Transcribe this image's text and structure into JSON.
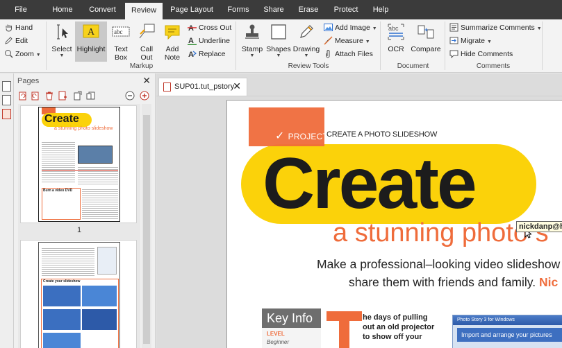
{
  "menu": [
    "File",
    "Home",
    "Convert",
    "Review",
    "Page Layout",
    "Forms",
    "Share",
    "Erase",
    "Protect",
    "Help"
  ],
  "menu_active": "Review",
  "ribbon": {
    "hand_group": {
      "hand": "Hand",
      "edit": "Edit",
      "zoom": "Zoom"
    },
    "markup": {
      "select": "Select",
      "highlight": "Highlight",
      "textbox_line1": "Text",
      "textbox_line2": "Box",
      "callout_line1": "Call",
      "callout_line2": "Out",
      "addnote_line1": "Add",
      "addnote_line2": "Note",
      "crossout": "Cross Out",
      "underline": "Underline",
      "replace": "Replace",
      "group_label": "Markup"
    },
    "review_tools": {
      "stamp": "Stamp",
      "shapes": "Shapes",
      "drawing": "Drawing",
      "add_image": "Add Image",
      "measure": "Measure",
      "attach_files": "Attach Files",
      "group_label": "Review Tools"
    },
    "document": {
      "ocr": "OCR",
      "compare": "Compare",
      "group_label": "Document"
    },
    "comments": {
      "summarize": "Summarize Comments",
      "migrate": "Migrate",
      "hide": "Hide Comments",
      "group_label": "Comments"
    }
  },
  "pages_panel": {
    "title": "Pages",
    "page1_number": "1",
    "thumb1": {
      "headline": "Create",
      "subhead": "a stunning photo slideshow",
      "box_title": "Burn a video DVD"
    },
    "thumb2": {
      "box_title": "Create your slideshow"
    }
  },
  "document": {
    "tab_label": "SUP01.tut_pstory",
    "project_label": "PROJECT",
    "project_title": "CREATE A PHOTO SLIDESHOW",
    "headline": "Create",
    "subhead": "a stunning photo s",
    "intro_line1": "Make a professional–looking video slideshow",
    "intro_line2": "share them with friends and family.",
    "intro_author": "Nic",
    "tooltip": "nickdanp@ho",
    "key_info_title": "Key Info",
    "key_info_level_label": "LEVEL",
    "key_info_level_value": "Beginner",
    "body_text": "he days of pulling out an old projector to show off your",
    "screenshot_title": "Photo Story 3 for Windows",
    "screenshot_heading": "Import and arrange your pictures"
  },
  "colors": {
    "accent_orange": "#ef6c3b",
    "yellow": "#fbd20a",
    "menubar": "#3b3b3b",
    "ribbon": "#f3f3f3"
  }
}
